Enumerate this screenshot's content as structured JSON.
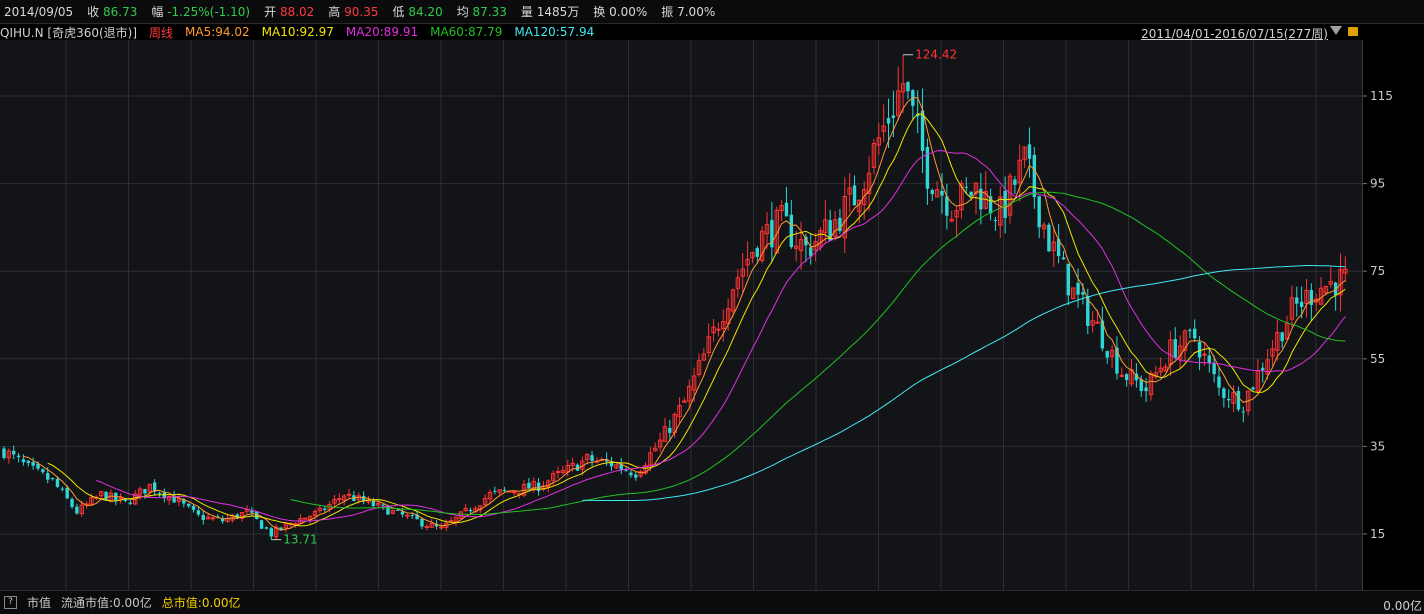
{
  "header": {
    "date": "2014/09/05",
    "close": {
      "label": "收",
      "value": "86.73"
    },
    "change": {
      "label": "幅",
      "value": "-1.25%(-1.10)"
    },
    "open": {
      "label": "开",
      "value": "88.02"
    },
    "high": {
      "label": "高",
      "value": "90.35"
    },
    "low": {
      "label": "低",
      "value": "84.20"
    },
    "avg": {
      "label": "均",
      "value": "87.33"
    },
    "volume": {
      "label": "量",
      "value": "1485万"
    },
    "turnover": {
      "label": "换",
      "value": "0.00%"
    },
    "amplitude": {
      "label": "振",
      "value": "7.00%"
    }
  },
  "subheader": {
    "symbol": "QIHU.N [奇虎360(退市)]",
    "period": "周线",
    "ma5": "MA5:94.02",
    "ma10": "MA10:92.97",
    "ma20": "MA20:89.91",
    "ma60": "MA60:87.79",
    "ma120": "MA120:57.94",
    "range": "2011/04/01-2016/07/15(277周)"
  },
  "footer": {
    "q_icon": "?",
    "market_cap_label": "市值",
    "float_cap": "流通市值:0.00亿",
    "total_cap": "总市值:0.00亿",
    "volume_axis": "0.00亿"
  },
  "colors": {
    "background": "#131418",
    "up": "#ff3333",
    "down": "#2fd6d6",
    "ma5": "#ff9a2e",
    "ma10": "#f2e600",
    "ma20": "#e030e0",
    "ma60": "#22c022",
    "ma120": "#40e8f0"
  },
  "chart_data": {
    "type": "candlestick",
    "title": "",
    "xlabel": "",
    "ylabel": "",
    "x_range": [
      "2011/04/01",
      "2016/07/15"
    ],
    "bars": 277,
    "ylim": [
      7,
      128
    ],
    "yticks": [
      15,
      35,
      55,
      75,
      95,
      115
    ],
    "annotations": [
      {
        "label": "124.42",
        "kind": "max"
      },
      {
        "label": "13.71",
        "kind": "min"
      }
    ],
    "series": [
      {
        "name": "MA5",
        "legend": "MA5:94.02"
      },
      {
        "name": "MA10",
        "legend": "MA10:92.97"
      },
      {
        "name": "MA20",
        "legend": "MA20:89.91"
      },
      {
        "name": "MA60",
        "legend": "MA60:87.79"
      },
      {
        "name": "MA120",
        "legend": "MA120:57.94"
      }
    ],
    "close_path": [
      [
        0,
        34
      ],
      [
        5,
        30
      ],
      [
        10,
        27
      ],
      [
        15,
        20
      ],
      [
        20,
        24
      ],
      [
        25,
        22
      ],
      [
        30,
        26
      ],
      [
        35,
        23
      ],
      [
        40,
        19
      ],
      [
        45,
        18
      ],
      [
        50,
        20
      ],
      [
        55,
        15
      ],
      [
        60,
        18
      ],
      [
        65,
        20
      ],
      [
        70,
        24
      ],
      [
        75,
        22
      ],
      [
        80,
        20
      ],
      [
        85,
        18
      ],
      [
        90,
        16
      ],
      [
        95,
        20
      ],
      [
        100,
        24
      ],
      [
        105,
        25
      ],
      [
        110,
        26
      ],
      [
        115,
        29
      ],
      [
        120,
        32
      ],
      [
        125,
        31
      ],
      [
        130,
        29
      ],
      [
        135,
        36
      ],
      [
        140,
        45
      ],
      [
        145,
        58
      ],
      [
        150,
        72
      ],
      [
        155,
        82
      ],
      [
        160,
        86
      ],
      [
        165,
        80
      ],
      [
        170,
        85
      ],
      [
        175,
        92
      ],
      [
        180,
        105
      ],
      [
        185,
        118
      ],
      [
        190,
        98
      ],
      [
        195,
        90
      ],
      [
        200,
        94
      ],
      [
        205,
        88
      ],
      [
        210,
        100
      ],
      [
        215,
        82
      ],
      [
        220,
        70
      ],
      [
        225,
        62
      ],
      [
        230,
        52
      ],
      [
        235,
        48
      ],
      [
        240,
        57
      ],
      [
        245,
        60
      ],
      [
        250,
        48
      ],
      [
        255,
        45
      ],
      [
        260,
        56
      ],
      [
        265,
        66
      ],
      [
        270,
        71
      ],
      [
        275,
        73
      ]
    ]
  }
}
